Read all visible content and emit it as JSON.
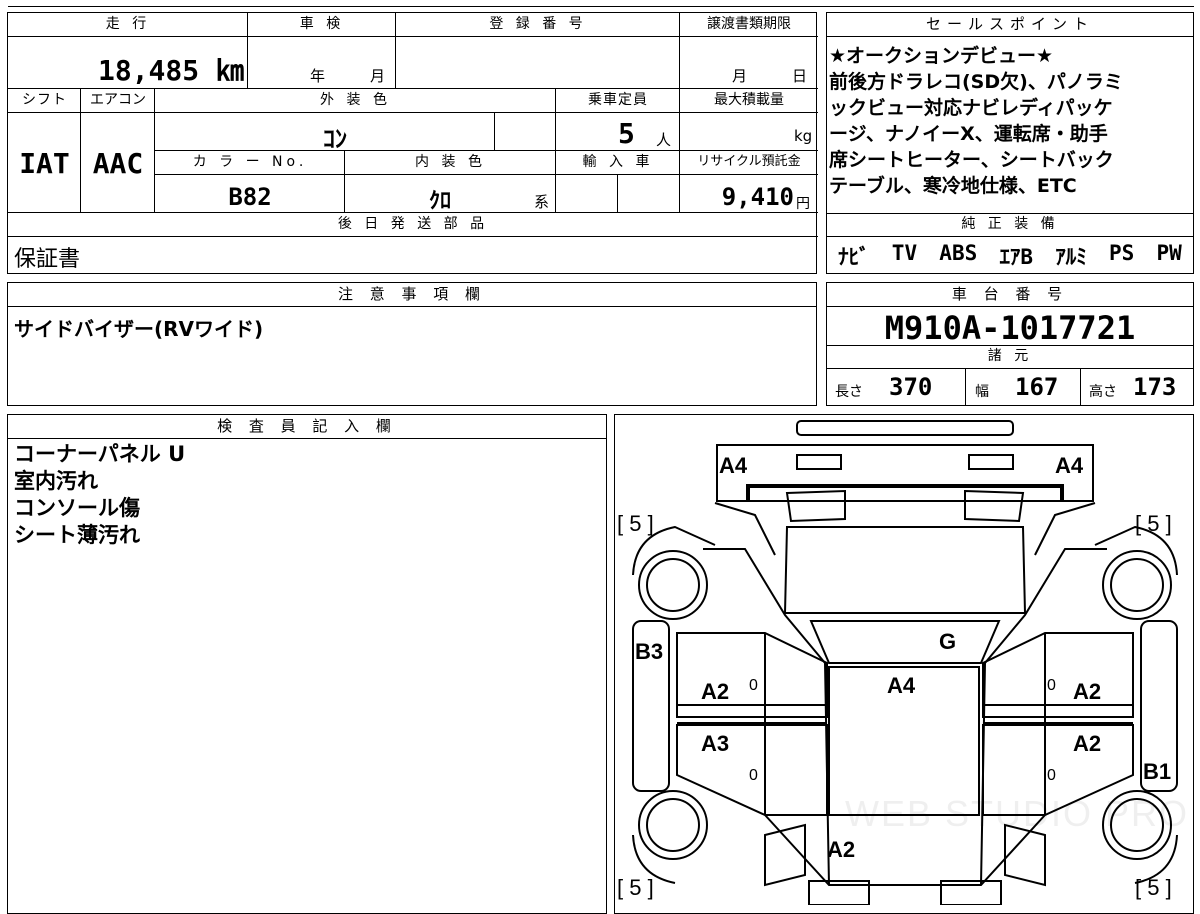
{
  "top_info": {
    "mileage_label": "走 行",
    "mileage": "18,485 ㎞",
    "inspection_label": "車 検",
    "inspection_year_unit": "年",
    "inspection_month_unit": "月",
    "registration_label": "登 録 番 号",
    "transfer_label": "譲渡書類期限",
    "transfer_month_unit": "月",
    "transfer_day_unit": "日",
    "shift_label": "シフト",
    "shift": "IAT",
    "aircon_label": "エアコン",
    "aircon": "AAC",
    "exterior_label": "外 装 色",
    "exterior": "ｺﾝ",
    "capacity_label": "乗車定員",
    "capacity": "5",
    "capacity_unit": "人",
    "maxload_label": "最大積載量",
    "maxload_unit": "kg",
    "color_no_label": "カ ラ ー No.",
    "color_no": "B82",
    "interior_label": "内 装 色",
    "interior": "ｸﾛ",
    "interior_unit": "系",
    "import_label": "輸 入 車",
    "recycle_label": "リサイクル預託金",
    "recycle": "9,410",
    "recycle_unit": "円"
  },
  "later_parts": {
    "label": "後 日 発 送 部 品",
    "value": "保証書"
  },
  "sales_points": {
    "label": "セールスポイント",
    "lines": [
      "★オークションデビュー★",
      "前後方ドラレコ(SD欠)、パノラミ",
      "ックビュー対応ナビレディパッケ",
      "ージ、ナノイーX、運転席・助手",
      "席シートヒーター、シートバック",
      "テーブル、寒冷地仕様、ETC"
    ]
  },
  "equipment": {
    "label": "純 正 装 備",
    "items": [
      "ﾅﾋﾞ",
      "TV",
      "ABS",
      "ｴｱB",
      "ｱﾙﾐ",
      "PS",
      "PW"
    ]
  },
  "notes": {
    "label": "注 意 事 項 欄",
    "value": "サイドバイザー(RVワイド)"
  },
  "chassis": {
    "label": "車 台 番 号",
    "value": "M910A-1017721",
    "specs_label": "諸 元",
    "length_label": "長さ",
    "length": "370",
    "width_label": "幅",
    "width": "167",
    "height_label": "高さ",
    "height": "173"
  },
  "inspector": {
    "label": "検 査 員 記 入 欄",
    "lines": [
      "コーナーパネル U",
      "室内汚れ",
      "コンソール傷",
      "シート薄汚れ"
    ]
  },
  "diagram": {
    "watermark": "WEB STUDIO PRO",
    "marks": {
      "a4_left": "A4",
      "a4_right": "A4",
      "tire_fl": "[ 5 ]",
      "tire_fr": "[ 5 ]",
      "tire_rl": "[ 5 ]",
      "tire_rr": "[ 5 ]",
      "b3": "B3",
      "g": "G",
      "a4_roof": "A4",
      "a2_left_front": "A2",
      "a2_right_front": "A2",
      "a3_left_rear": "A3",
      "a2_right_rear": "A2",
      "b1": "B1",
      "a2_back": "A2",
      "zero_1": "0",
      "zero_2": "0",
      "zero_3": "0",
      "zero_4": "0"
    }
  }
}
